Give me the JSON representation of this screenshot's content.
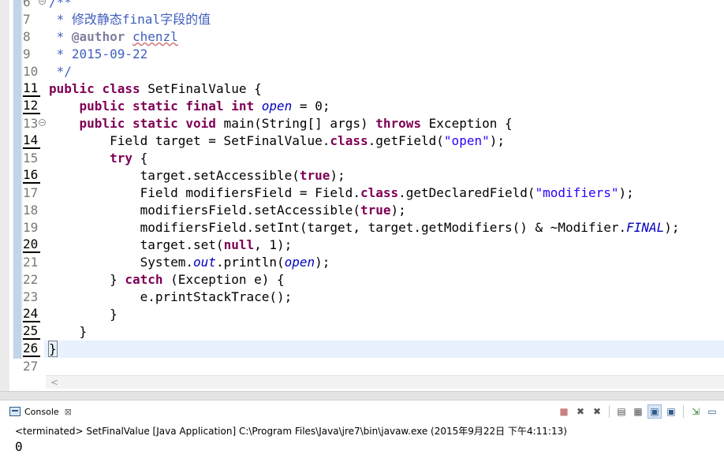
{
  "editor": {
    "lines": [
      {
        "n": "6",
        "segs": [
          {
            "t": "/**",
            "c": "cm"
          }
        ]
      },
      {
        "n": "7",
        "segs": [
          {
            "t": " * 修改静态final字段的值",
            "c": "cm"
          }
        ]
      },
      {
        "n": "8",
        "segs": [
          {
            "t": " * ",
            "c": "cm"
          },
          {
            "t": "@author",
            "c": "tag"
          },
          {
            "t": " ",
            "c": "cm"
          },
          {
            "t": "chenzl",
            "c": "cm underl"
          }
        ]
      },
      {
        "n": "9",
        "segs": [
          {
            "t": " * 2015-09-22",
            "c": "cm"
          }
        ]
      },
      {
        "n": "10",
        "segs": [
          {
            "t": " */",
            "c": "cm"
          }
        ]
      },
      {
        "n": "11",
        "segs": [
          {
            "t": "public",
            "c": "kw"
          },
          {
            "t": " "
          },
          {
            "t": "class",
            "c": "kw"
          },
          {
            "t": " SetFinalValue {"
          }
        ]
      },
      {
        "n": "12",
        "segs": [
          {
            "t": "    "
          },
          {
            "t": "public",
            "c": "kw"
          },
          {
            "t": " "
          },
          {
            "t": "static",
            "c": "kw"
          },
          {
            "t": " "
          },
          {
            "t": "final",
            "c": "kw"
          },
          {
            "t": " "
          },
          {
            "t": "int",
            "c": "kw"
          },
          {
            "t": " "
          },
          {
            "t": "open",
            "c": "fi"
          },
          {
            "t": " = 0;"
          }
        ]
      },
      {
        "n": "13",
        "segs": [
          {
            "t": "    "
          },
          {
            "t": "public",
            "c": "kw"
          },
          {
            "t": " "
          },
          {
            "t": "static",
            "c": "kw"
          },
          {
            "t": " "
          },
          {
            "t": "void",
            "c": "kw"
          },
          {
            "t": " main(String[] args) "
          },
          {
            "t": "throws",
            "c": "kw"
          },
          {
            "t": " Exception {"
          }
        ]
      },
      {
        "n": "14",
        "segs": [
          {
            "t": "        Field target = SetFinalValue."
          },
          {
            "t": "class",
            "c": "kw"
          },
          {
            "t": ".getField("
          },
          {
            "t": "\"open\"",
            "c": "str"
          },
          {
            "t": ");"
          }
        ]
      },
      {
        "n": "15",
        "segs": [
          {
            "t": "        "
          },
          {
            "t": "try",
            "c": "kw"
          },
          {
            "t": " {"
          }
        ]
      },
      {
        "n": "16",
        "segs": [
          {
            "t": "            target.setAccessible("
          },
          {
            "t": "true",
            "c": "kw"
          },
          {
            "t": ");"
          }
        ]
      },
      {
        "n": "17",
        "segs": [
          {
            "t": "            Field modifiersField = Field."
          },
          {
            "t": "class",
            "c": "kw"
          },
          {
            "t": ".getDeclaredField("
          },
          {
            "t": "\"modifiers\"",
            "c": "str"
          },
          {
            "t": ");"
          }
        ]
      },
      {
        "n": "18",
        "segs": [
          {
            "t": "            modifiersField.setAccessible("
          },
          {
            "t": "true",
            "c": "kw"
          },
          {
            "t": ");"
          }
        ]
      },
      {
        "n": "19",
        "segs": [
          {
            "t": "            modifiersField.setInt(target, target.getModifiers() & ~Modifier."
          },
          {
            "t": "FINAL",
            "c": "fi"
          },
          {
            "t": ");"
          }
        ]
      },
      {
        "n": "20",
        "segs": [
          {
            "t": "            target.set("
          },
          {
            "t": "null",
            "c": "kw"
          },
          {
            "t": ", 1);"
          }
        ]
      },
      {
        "n": "21",
        "segs": [
          {
            "t": "            System."
          },
          {
            "t": "out",
            "c": "fi"
          },
          {
            "t": ".println("
          },
          {
            "t": "open",
            "c": "fi"
          },
          {
            "t": ");"
          }
        ]
      },
      {
        "n": "22",
        "segs": [
          {
            "t": "        } "
          },
          {
            "t": "catch",
            "c": "kw"
          },
          {
            "t": " (Exception e) {"
          }
        ]
      },
      {
        "n": "23",
        "segs": [
          {
            "t": "            e.printStackTrace();"
          }
        ]
      },
      {
        "n": "24",
        "segs": [
          {
            "t": "        }"
          }
        ]
      },
      {
        "n": "25",
        "segs": [
          {
            "t": "    }"
          }
        ]
      },
      {
        "n": "26",
        "segs": [
          {
            "t": "}",
            "c": "caret-br"
          }
        ]
      },
      {
        "n": "27",
        "segs": []
      }
    ],
    "marked_lines": [
      "11",
      "12",
      "14",
      "16",
      "20",
      "24",
      "25",
      "26"
    ],
    "fold_lines": [
      "6",
      "13"
    ],
    "fold_glyph": "⊖",
    "scroll_left_glyph": "<"
  },
  "console": {
    "tab_label": "Console",
    "tab_close_glyph": "⊠",
    "status": "<terminated> SetFinalValue [Java Application] C:\\Program Files\\Java\\jre7\\bin\\javaw.exe (2015年9月22日 下午4:11:13)",
    "output": "0",
    "toolbar_icons": [
      {
        "name": "terminate-icon",
        "glyph": "■",
        "color": "#c98080",
        "selected": false
      },
      {
        "name": "remove-launch-icon",
        "glyph": "✖",
        "color": "#555555",
        "selected": false
      },
      {
        "name": "remove-all-terminated-icon",
        "glyph": "✖",
        "color": "#555555",
        "selected": false
      },
      {
        "sep": true
      },
      {
        "name": "clear-console-icon",
        "glyph": "▤",
        "color": "#555555",
        "selected": false
      },
      {
        "name": "scroll-lock-icon",
        "glyph": "▦",
        "color": "#555555",
        "selected": false
      },
      {
        "name": "show-console-on-output-icon",
        "glyph": "▣",
        "color": "#2e5b8a",
        "selected": true
      },
      {
        "name": "show-console-on-error-icon",
        "glyph": "▣",
        "color": "#2e5b8a",
        "selected": false
      },
      {
        "sep": true
      },
      {
        "name": "pin-console-icon",
        "glyph": "⇲",
        "color": "#2a7a2a",
        "selected": false
      },
      {
        "name": "display-selected-console-icon",
        "glyph": "▭",
        "color": "#2e5b8a",
        "selected": false
      }
    ]
  },
  "colors": {
    "keyword": "#7f0055",
    "string": "#2a00ff",
    "comment": "#3f5fbf",
    "field": "#0000c0",
    "current_line": "#e8f2fe"
  }
}
